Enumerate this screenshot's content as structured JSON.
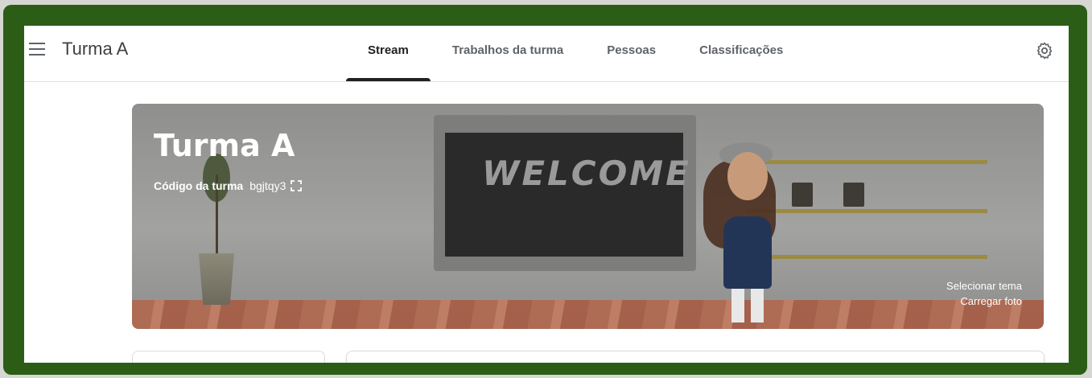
{
  "header": {
    "title": "Turma A",
    "tabs": [
      {
        "label": "Stream",
        "active": true
      },
      {
        "label": "Trabalhos da turma",
        "active": false
      },
      {
        "label": "Pessoas",
        "active": false
      },
      {
        "label": "Classificações",
        "active": false
      }
    ]
  },
  "banner": {
    "title": "Turma A",
    "code_label": "Código da turma",
    "code_value": "bgjtqy3",
    "chalkboard_text": "WELCOME",
    "select_theme": "Selecionar tema",
    "upload_photo": "Carregar foto"
  },
  "icons": {
    "menu": "hamburger-menu-icon",
    "settings": "gear-icon",
    "expand": "fullscreen-expand-icon"
  },
  "colors": {
    "frame": "#2b5d17",
    "active_tab": "#202124",
    "text": "#3c4043"
  }
}
